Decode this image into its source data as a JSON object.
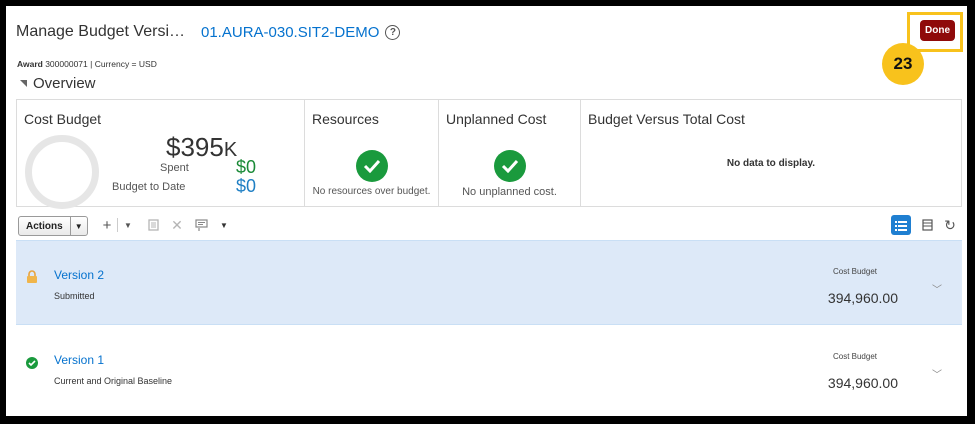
{
  "header": {
    "title": "Manage Budget Versi…",
    "identifier": "01.AURA-030.SIT2-DEMO",
    "help_icon": "?",
    "done_label": "Done",
    "step_number": "23"
  },
  "meta": {
    "award_label": "Award",
    "award_value": "300000071",
    "currency_text": "Currency = USD"
  },
  "overview": {
    "label": "Overview"
  },
  "tiles": {
    "cost_budget": {
      "title": "Cost Budget",
      "amount": "$395",
      "amount_suffix": "K",
      "spent_label": "Spent",
      "spent_value": "$0",
      "budget_to_date_label": "Budget to Date",
      "budget_to_date_value": "$0"
    },
    "resources": {
      "title": "Resources",
      "note": "No resources over budget."
    },
    "unplanned_cost": {
      "title": "Unplanned Cost",
      "note": "No unplanned cost."
    },
    "budget_vs_total": {
      "title": "Budget Versus Total Cost",
      "note": "No data to display."
    }
  },
  "toolbar": {
    "actions_label": "Actions"
  },
  "versions": [
    {
      "name": "Version 2",
      "status": "Submitted",
      "cost_budget_label": "Cost Budget",
      "cost_budget_value": "394,960.00",
      "icon": "lock-icon"
    },
    {
      "name": "Version 1",
      "status": "Current and Original Baseline",
      "cost_budget_label": "Cost Budget",
      "cost_budget_value": "394,960.00",
      "icon": "check-circle-icon"
    }
  ],
  "colors": {
    "link": "#0572ce",
    "done": "#8f0a0a",
    "highlight": "#f8c21c",
    "success": "#1a9a3d",
    "selected_row": "#dde9f8"
  }
}
